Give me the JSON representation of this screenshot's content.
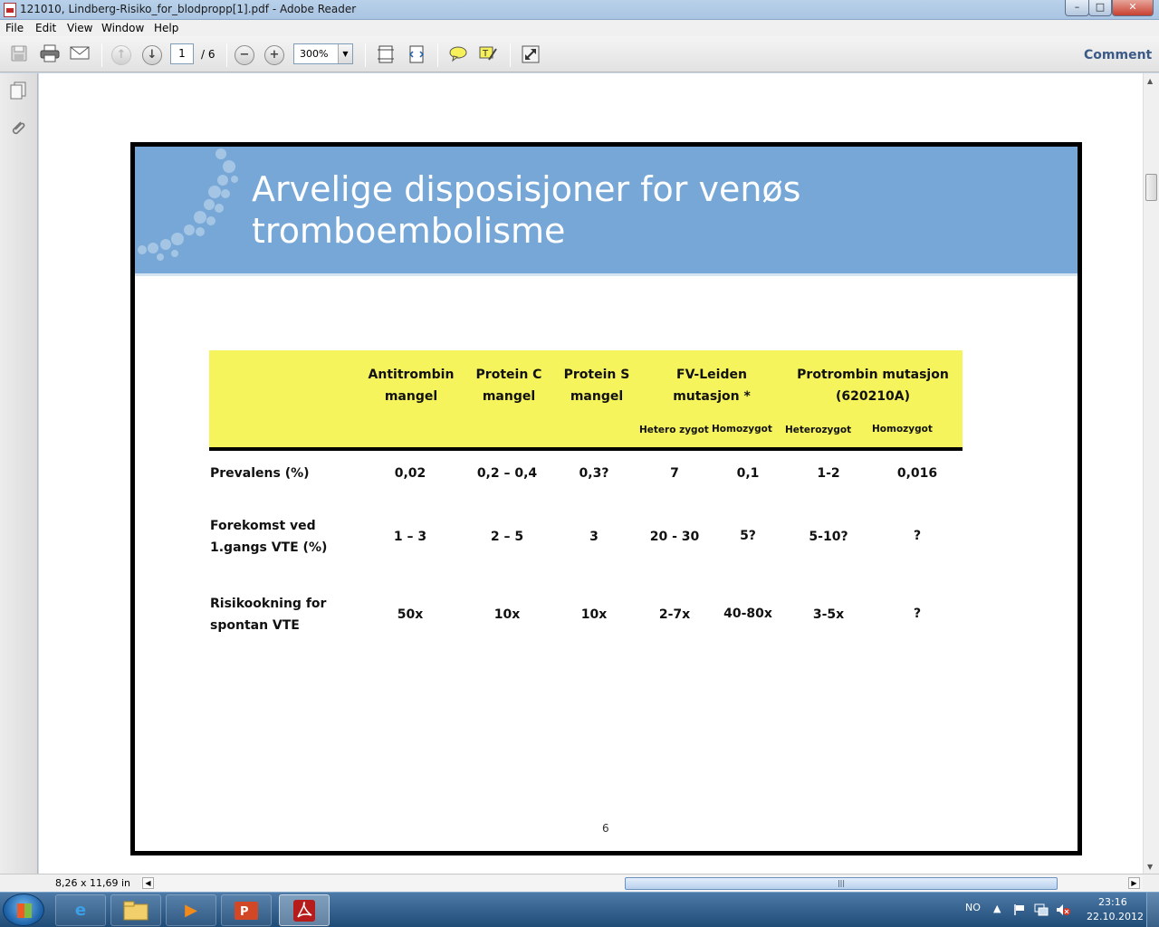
{
  "window": {
    "title": "121010, Lindberg-Risiko_for_blodpropp[1].pdf - Adobe Reader",
    "buttons": {
      "minimize": "–",
      "maximize": "□",
      "close": "✕"
    }
  },
  "menu": [
    "File",
    "Edit",
    "View",
    "Window",
    "Help"
  ],
  "toolbar": {
    "page_current": "1",
    "page_total": "/ 6",
    "zoom": "300%",
    "comment_label": "Comment",
    "icons": [
      "save-icon",
      "print-icon",
      "email-icon",
      "prev-page-icon",
      "next-page-icon",
      "zoom-out-icon",
      "zoom-in-icon",
      "fit-page-icon",
      "fit-width-icon",
      "sticky-note-icon",
      "highlight-icon",
      "expand-icon"
    ]
  },
  "leftnav": {
    "icons": [
      "pages-icon",
      "attachment-icon"
    ]
  },
  "slide": {
    "title_line1": "Arvelige disposisjoner for venøs",
    "title_line2": "tromboembolisme",
    "header_bg": "#76a7d6",
    "table_header_bg": "#f6f45d",
    "headers": {
      "antitrombin": [
        "Antitrombin",
        "mangel"
      ],
      "protein_c": [
        "Protein C",
        "mangel"
      ],
      "protein_s": [
        "Protein S",
        "mangel"
      ],
      "fv_leiden": [
        "FV-Leiden",
        "mutasjon *"
      ],
      "protrombin": [
        "Protrombin mutasjon",
        "(620210A)"
      ]
    },
    "subheaders": {
      "fv_hetero": "Hetero zygot",
      "fv_homo": "Homozygot",
      "pt_hetero": "Heterozygot",
      "pt_homo": "Homozygot"
    },
    "rows": [
      {
        "label": [
          "Prevalens (%)"
        ],
        "values": [
          "0,02",
          "0,2 – 0,4",
          "0,3?",
          "7",
          "0,1",
          "1-2",
          "0,016"
        ]
      },
      {
        "label": [
          "Forekomst ved",
          "1.gangs VTE (%)"
        ],
        "values": [
          "1 – 3",
          "2 – 5",
          "3",
          "20 - 30",
          "5?",
          "5-10?",
          "?"
        ]
      },
      {
        "label": [
          "Risikookning for",
          "spontan VTE"
        ],
        "values": [
          "50x",
          "10x",
          "10x",
          "2-7x",
          "40-80x",
          "3-5x",
          "?"
        ]
      }
    ],
    "page_number": "6"
  },
  "status": {
    "page_size": "8,26 x 11,69 in"
  },
  "taskbar": {
    "apps": [
      "internet-explorer",
      "file-explorer",
      "media-player",
      "powerpoint",
      "adobe-reader"
    ],
    "lang": "NO",
    "time": "23:16",
    "date": "22.10.2012"
  }
}
